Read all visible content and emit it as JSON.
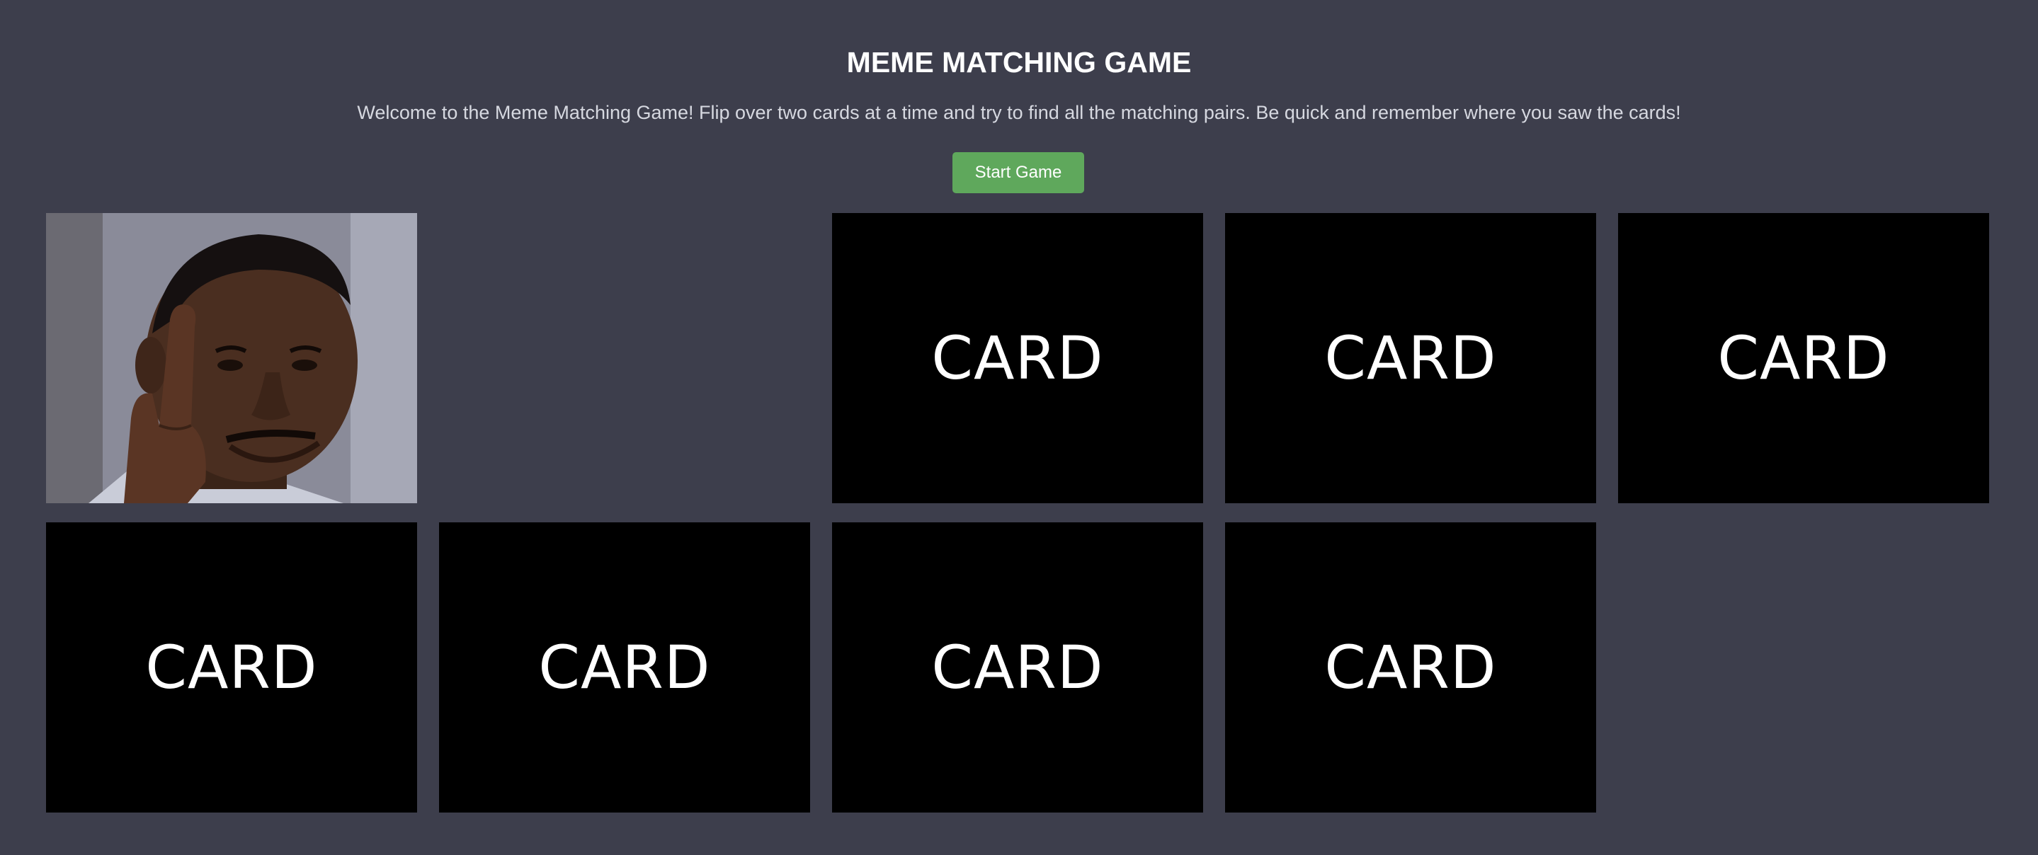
{
  "page": {
    "title": "MEME MATCHING GAME",
    "welcome": "Welcome to the Meme Matching Game! Flip over two cards at a time and try to find all the matching pairs. Be quick and remember where you saw the cards!",
    "start_label": "Start Game"
  },
  "colors": {
    "background": "#3d3e4c",
    "start_button": "#5fa85c",
    "card_back": "#000000",
    "card_text": "#ffffff"
  },
  "cards": [
    {
      "state": "flipped",
      "label": "",
      "image": "roll-safe-meme"
    },
    {
      "state": "matched",
      "label": ""
    },
    {
      "state": "hidden",
      "label": "CARD"
    },
    {
      "state": "hidden",
      "label": "CARD"
    },
    {
      "state": "hidden",
      "label": "CARD"
    },
    {
      "state": "hidden",
      "label": "CARD"
    },
    {
      "state": "hidden",
      "label": "CARD"
    },
    {
      "state": "hidden",
      "label": "CARD"
    },
    {
      "state": "hidden",
      "label": "CARD"
    }
  ]
}
